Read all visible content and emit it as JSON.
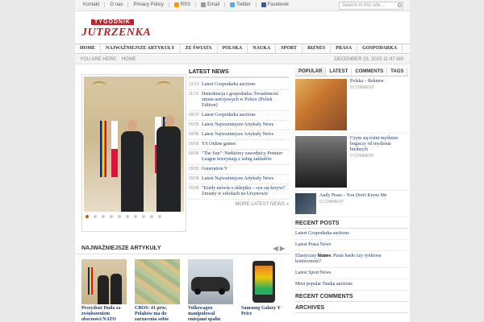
{
  "topbar": {
    "links": [
      "Kontakt",
      "O nas",
      "Privacy Policy",
      "RSS",
      "Email",
      "Twitter",
      "Facebook"
    ],
    "search_placeholder": "Search in this site..."
  },
  "logo": {
    "small": "TYGODNIK",
    "big": "JUTRZENKA"
  },
  "nav": [
    "HOME",
    "NAJWAŻNIEJSZE ARTYKUŁY",
    "ZE ŚWIATA",
    "POLSKA",
    "NAUKA",
    "SPORT",
    "BIZNES",
    "PRASA",
    "GOSPODARKA"
  ],
  "breadcrumb": {
    "prefix": "YOU ARE HERE:",
    "current": "HOME",
    "date": "DECEMBER 23, 2015 11:47 AM"
  },
  "latest_news": {
    "heading": "LATEST NEWS",
    "items": [
      {
        "date": "12/14",
        "title": "Latest Gospodarka auctions"
      },
      {
        "date": "11/19",
        "title": "Demokracja i gospodarka: Świadomość zmian ustrojowych w Polsce (Polish Edition)"
      },
      {
        "date": "09/20",
        "title": "Latest Gospodarka auctions"
      },
      {
        "date": "09/08",
        "title": "Latest Najważniejsze Artykuły News"
      },
      {
        "date": "09/08",
        "title": "Latest Najważniejsze Artykuły News"
      },
      {
        "date": "09/08",
        "title": "YS Online games"
      },
      {
        "date": "09/08",
        "title": "\"The Sun\": Niektórzy zawodnicy Premier League korzystają z usług zakładów"
      },
      {
        "date": "09/08",
        "title": "Generation Y"
      },
      {
        "date": "09/08",
        "title": "Latest Najważniejsze Artykuły News"
      },
      {
        "date": "09/08",
        "title": "\"Kiedy mówię o skłepiku – syn się krzywi\". Zmiany w szkołach na Ursynowie"
      }
    ],
    "more": "MORE LATEST NEWS »"
  },
  "tabs": [
    "POPULAR",
    "LATEST",
    "COMMENTS",
    "TAGS"
  ],
  "popular": [
    {
      "title": "Polska – Reknew",
      "comments": "0 COMMENT"
    },
    {
      "title": "Czym się różni myślenie bogaczy od myślenia biednych",
      "comments": "0 COMMENT"
    },
    {
      "title": "Andy Prasa – You Don't Know Me",
      "comments": "0 COMMENT"
    }
  ],
  "recent_posts": {
    "heading": "RECENT POSTS",
    "items": [
      {
        "prefix": "Latest Gospodarka auctions",
        "bold": "",
        "suffix": ""
      },
      {
        "prefix": "Latest Prasa News",
        "bold": "",
        "suffix": ""
      },
      {
        "prefix": "Elastyczny ",
        "bold": "biznes",
        "suffix": ": Puste hasło czy rynkowa konieczność?"
      },
      {
        "prefix": "Latest Sport News",
        "bold": "",
        "suffix": ""
      },
      {
        "prefix": "Most popular Nauka auctions",
        "bold": "",
        "suffix": ""
      }
    ]
  },
  "recent_comments_heading": "RECENT COMMENTS",
  "archives_heading": "ARCHIVES",
  "most_important": {
    "heading": "NAJWAŻNIEJSZE ARTYKUŁY",
    "cards": [
      {
        "title": "Prezydent Duda za zwiększeniem obecności NATO"
      },
      {
        "title": "CBOS: 41 proc. Polaków ma do zarzucenia sobie"
      },
      {
        "title": "Volkswagen manipulował emisjami spalin"
      },
      {
        "title": "Samsung Galaxy Y Price"
      }
    ]
  },
  "colors": {
    "brand_red": "#c0202a",
    "link_blue": "#1f3c6e",
    "active_dot": "#d35400"
  }
}
